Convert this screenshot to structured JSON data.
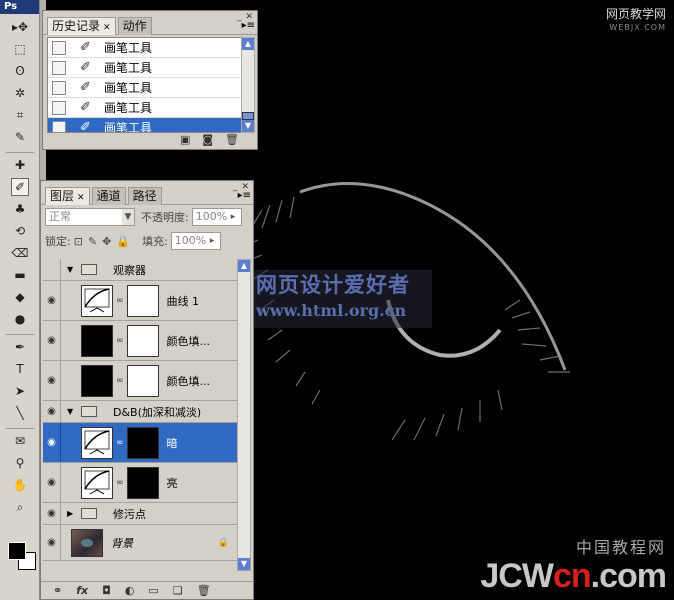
{
  "toolbar": {
    "app_badge": "Ps",
    "tools": [
      {
        "name": "move-tool",
        "glyph": "▸✥"
      },
      {
        "name": "marquee-tool",
        "glyph": "⬚"
      },
      {
        "name": "lasso-tool",
        "glyph": "ʘ"
      },
      {
        "name": "magic-wand-tool",
        "glyph": "✲"
      },
      {
        "name": "crop-tool",
        "glyph": "⌗"
      },
      {
        "name": "slice-tool",
        "glyph": "✎"
      },
      {
        "name": "healing-brush-tool",
        "glyph": "✚"
      },
      {
        "name": "brush-tool",
        "glyph": "✐"
      },
      {
        "name": "clone-stamp-tool",
        "glyph": "♣"
      },
      {
        "name": "history-brush-tool",
        "glyph": "⟲"
      },
      {
        "name": "eraser-tool",
        "glyph": "⌫"
      },
      {
        "name": "gradient-tool",
        "glyph": "▬"
      },
      {
        "name": "blur-tool",
        "glyph": "◆"
      },
      {
        "name": "dodge-tool",
        "glyph": "●"
      },
      {
        "name": "pen-tool",
        "glyph": "✒"
      },
      {
        "name": "type-tool",
        "glyph": "T"
      },
      {
        "name": "path-selection-tool",
        "glyph": "➤"
      },
      {
        "name": "line-tool",
        "glyph": "╲"
      },
      {
        "name": "notes-tool",
        "glyph": "✉"
      },
      {
        "name": "eyedropper-tool",
        "glyph": "⚲"
      },
      {
        "name": "hand-tool",
        "glyph": "✋"
      },
      {
        "name": "zoom-tool",
        "glyph": "⌕"
      }
    ]
  },
  "history": {
    "tabs": [
      {
        "label": "历史记录",
        "active": true
      },
      {
        "label": "动作",
        "active": false
      }
    ],
    "rows": [
      {
        "label": "画笔工具",
        "selected": false
      },
      {
        "label": "画笔工具",
        "selected": false
      },
      {
        "label": "画笔工具",
        "selected": false
      },
      {
        "label": "画笔工具",
        "selected": false
      },
      {
        "label": "画笔工具",
        "selected": true
      }
    ],
    "footer_icons": [
      "new-document-icon",
      "snapshot-icon",
      "trash-icon"
    ]
  },
  "layers": {
    "tabs": [
      {
        "label": "图层",
        "active": true
      },
      {
        "label": "通道",
        "active": false
      },
      {
        "label": "路径",
        "active": false
      }
    ],
    "blend_mode": "正常",
    "opacity_label": "不透明度:",
    "opacity_value": "100%",
    "lock_label": "锁定:",
    "fill_label": "填充:",
    "fill_value": "100%",
    "items": [
      {
        "type": "group",
        "name": "观察器",
        "visible": false,
        "expanded": true
      },
      {
        "type": "adjust",
        "name": "曲线 1",
        "visible": true,
        "thumb": "curve",
        "mask": "white"
      },
      {
        "type": "fill",
        "name": "颜色填...",
        "visible": true,
        "thumb": "black",
        "mask": "white"
      },
      {
        "type": "fill",
        "name": "颜色填...",
        "visible": true,
        "thumb": "black",
        "mask": "white"
      },
      {
        "type": "group",
        "name": "D&B(加深和减淡)",
        "visible": true,
        "expanded": true
      },
      {
        "type": "adjust",
        "name": "暗",
        "visible": true,
        "thumb": "curve",
        "mask": "black",
        "selected": true
      },
      {
        "type": "adjust",
        "name": "亮",
        "visible": true,
        "thumb": "curve",
        "mask": "black"
      },
      {
        "type": "group",
        "name": "修污点",
        "visible": true,
        "expanded": false
      },
      {
        "type": "background",
        "name": "背景",
        "visible": true,
        "locked": true
      }
    ],
    "footer_icons": [
      "link-icon",
      "fx-icon",
      "mask-icon",
      "adjustment-icon",
      "folder-icon",
      "new-layer-icon",
      "trash-icon"
    ]
  },
  "canvas": {
    "watermark_top": "网页教学网",
    "watermark_top_sub": "WEBJX.COM",
    "watermark_mid_1": "网页设计爱好者",
    "watermark_mid_2": "www.html.org.cn",
    "watermark_bottom_cn": "中国教程网",
    "watermark_bottom_en_a": "JCW",
    "watermark_bottom_en_b": "cn",
    "watermark_bottom_en_c": ".com"
  }
}
